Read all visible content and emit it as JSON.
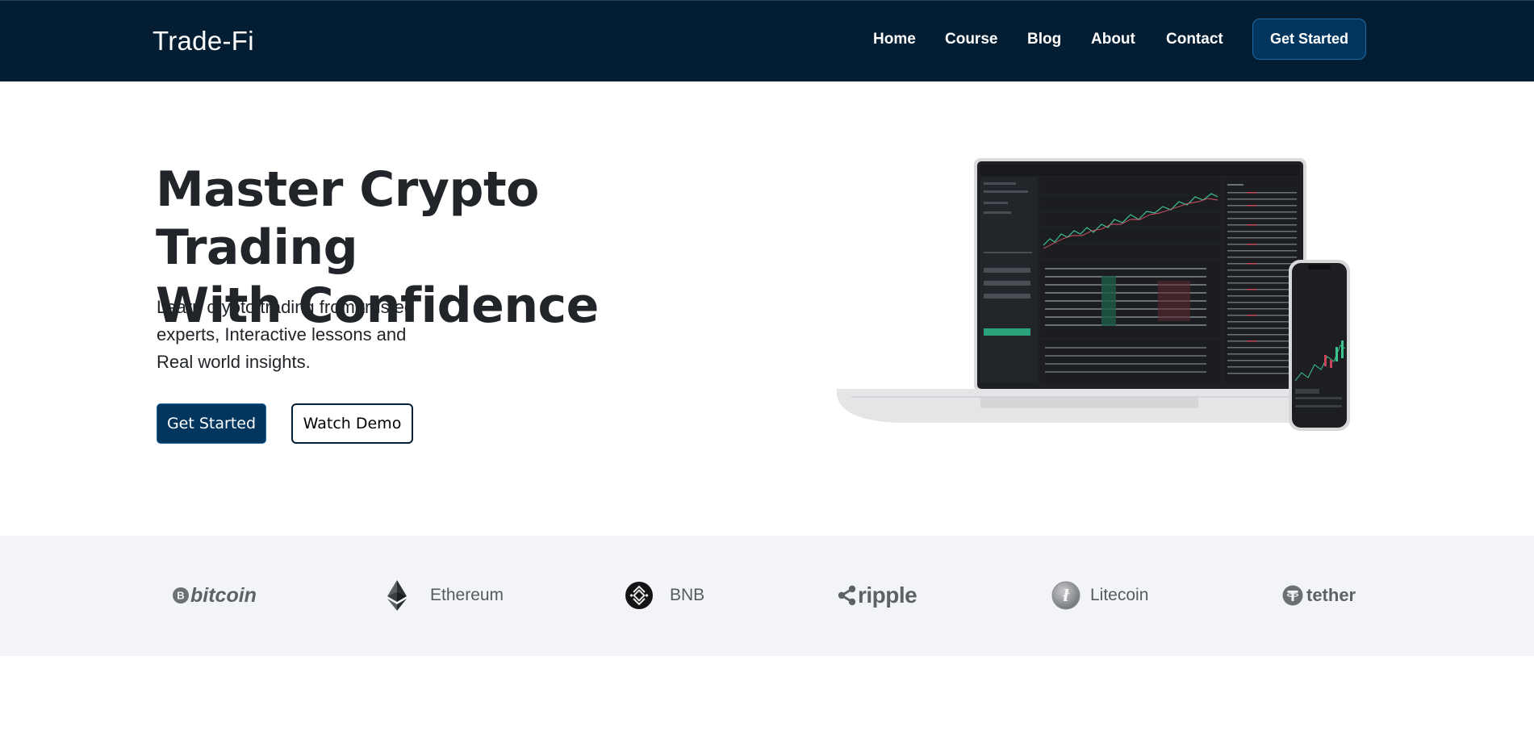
{
  "navbar": {
    "brand": "Trade-Fi",
    "links": [
      "Home",
      "Course",
      "Blog",
      "About",
      "Contact"
    ],
    "cta_label": "Get Started"
  },
  "hero": {
    "title_line1": "Master Crypto Trading",
    "title_line2": "With Confidence",
    "subtitle_line1": "Learn crypto trading from trusted",
    "subtitle_line2": "experts, Interactive lessons and",
    "subtitle_line3": "Real world insights.",
    "primary_button": "Get Started",
    "secondary_button": "Watch Demo"
  },
  "partners": [
    {
      "name": "bitcoin",
      "icon": "bitcoin-icon"
    },
    {
      "name": "Ethereum",
      "icon": "ethereum-icon"
    },
    {
      "name": "BNB",
      "icon": "bnb-icon"
    },
    {
      "name": "ripple",
      "icon": "ripple-icon"
    },
    {
      "name": "Litecoin",
      "icon": "litecoin-icon"
    },
    {
      "name": "tether",
      "icon": "tether-icon"
    }
  ],
  "colors": {
    "navbar_bg": "#031d32",
    "primary": "#02365e",
    "strip_bg": "#f3f4f8"
  }
}
